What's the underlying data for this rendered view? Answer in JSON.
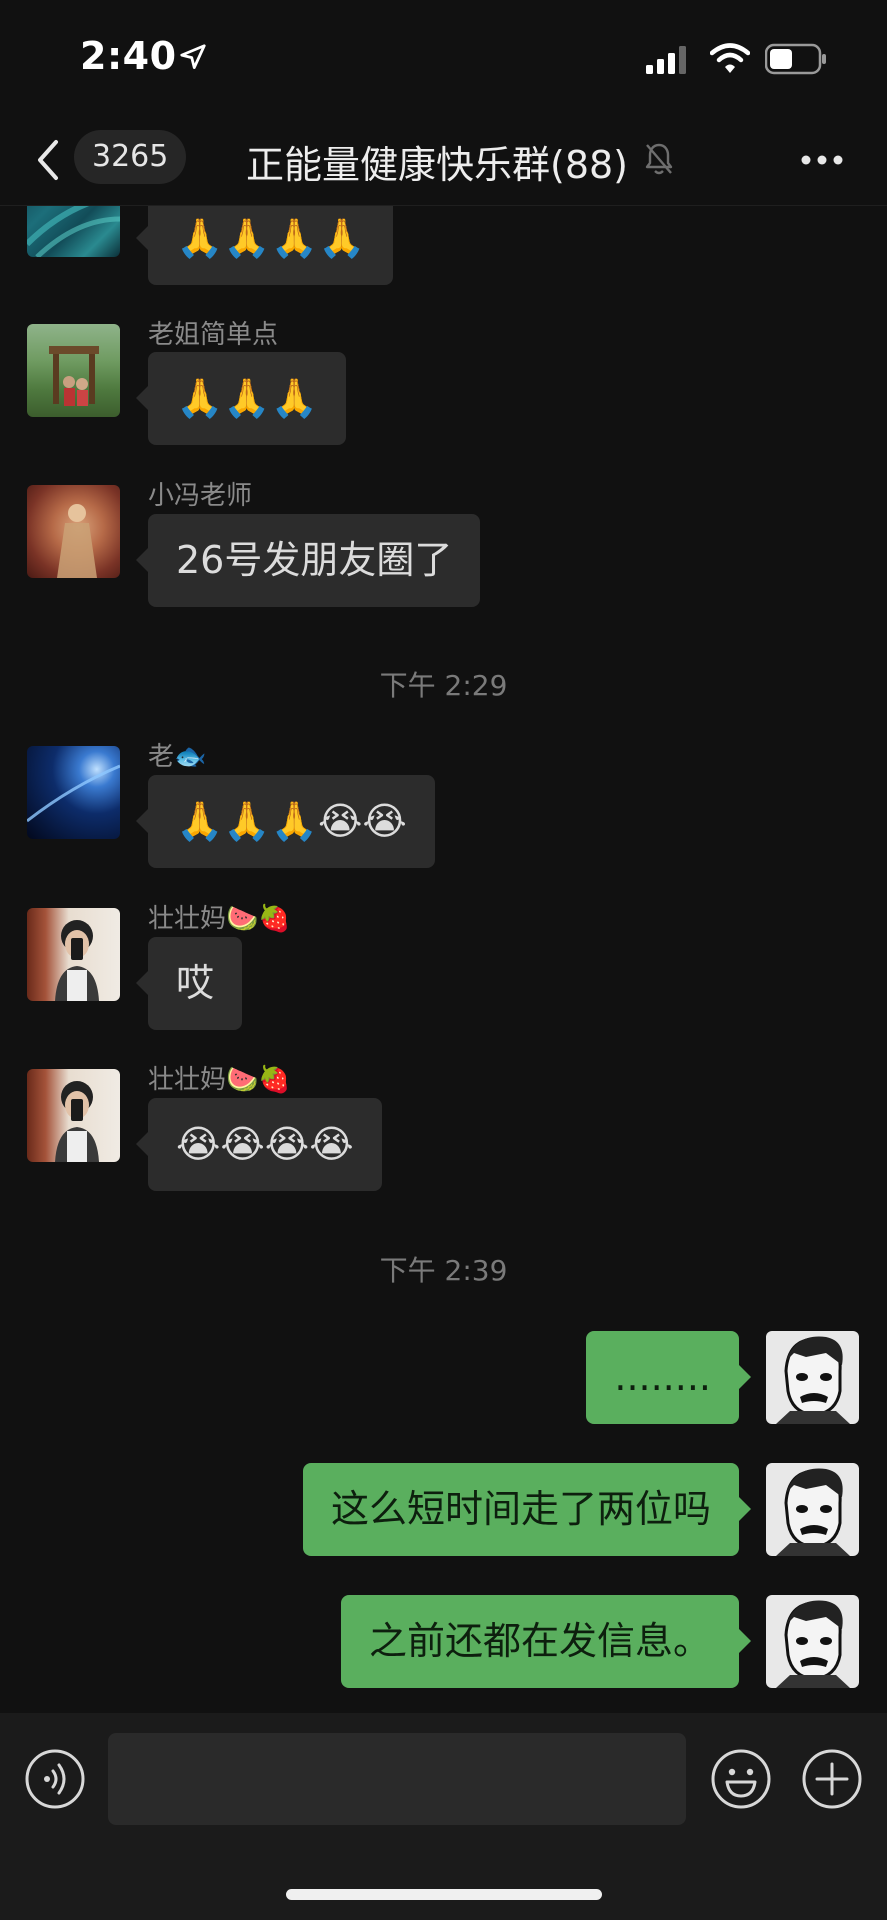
{
  "status_bar": {
    "time": "2:40"
  },
  "nav": {
    "back_count": "3265",
    "title": "正能量健康快乐群(88)"
  },
  "messages": [
    {
      "sender": "",
      "text": "🙏🙏🙏🙏"
    },
    {
      "sender": "老姐简单点",
      "text": "🙏🙏🙏"
    },
    {
      "sender": "小冯老师",
      "text": "26号发朋友圈了"
    },
    {
      "timestamp": "下午 2:29"
    },
    {
      "sender": "老🐟",
      "text": "🙏🙏🙏😭😭"
    },
    {
      "sender": "壮壮妈🍉🍓",
      "text": "哎"
    },
    {
      "sender": "壮壮妈🍉🍓",
      "text": "😭😭😭😭"
    },
    {
      "timestamp": "下午 2:39"
    },
    {
      "sender": "me",
      "text": "........"
    },
    {
      "sender": "me",
      "text": "这么短时间走了两位吗"
    },
    {
      "sender": "me",
      "text": "之前还都在发信息。"
    }
  ],
  "colors": {
    "background": "#111111",
    "incoming_bubble": "#2c2c2c",
    "outgoing_bubble": "#5aaf5e",
    "input_bar": "#1b1b1b"
  },
  "icons": [
    "location-arrow-icon",
    "signal-icon",
    "wifi-icon",
    "battery-icon",
    "back-chevron-icon",
    "mute-bell-icon",
    "more-dots-icon",
    "voice-icon",
    "emoji-icon",
    "plus-icon"
  ]
}
